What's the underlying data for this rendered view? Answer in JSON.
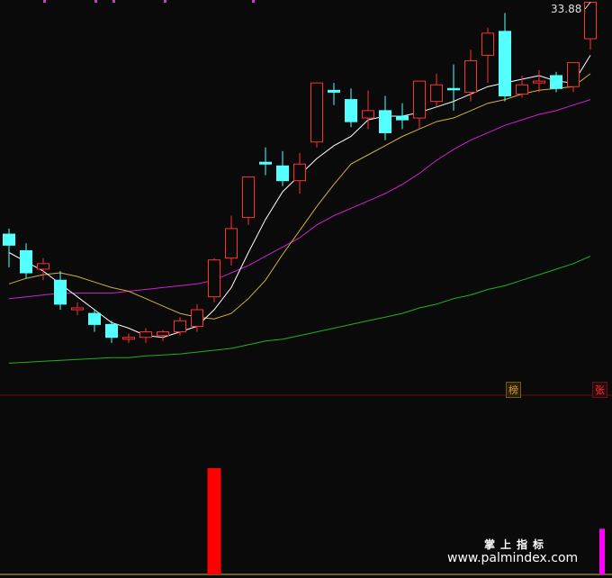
{
  "price_label": "33.88",
  "tags": {
    "bang": "榜",
    "zhang": "张"
  },
  "watermark": {
    "line1": "掌上指标",
    "line2": "www.palmindex.com"
  },
  "colors": {
    "bull": "#ff3030",
    "bear": "#54ffff",
    "ma5": "#ffffff",
    "ma10": "#d4b03a",
    "ma20": "#d020d0",
    "ma60": "#20b020",
    "volume_up": "#ff0000",
    "volume_magenta": "#ff00ff",
    "divider": "#6b1010"
  },
  "chart_data": {
    "type": "candlestick",
    "y_range": [
      13.0,
      34.0
    ],
    "candles": [
      {
        "open": 21.3,
        "close": 20.7,
        "high": 21.6,
        "low": 19.5,
        "up": false
      },
      {
        "open": 20.4,
        "close": 19.2,
        "high": 20.8,
        "low": 18.9,
        "up": false
      },
      {
        "open": 19.4,
        "close": 19.7,
        "high": 20.0,
        "low": 18.8,
        "up": true
      },
      {
        "open": 18.8,
        "close": 17.5,
        "high": 19.3,
        "low": 17.2,
        "up": false
      },
      {
        "open": 17.2,
        "close": 17.3,
        "high": 17.6,
        "low": 16.9,
        "up": true
      },
      {
        "open": 17.0,
        "close": 16.4,
        "high": 17.2,
        "low": 16.0,
        "up": false
      },
      {
        "open": 16.4,
        "close": 15.7,
        "high": 16.6,
        "low": 15.4,
        "up": false
      },
      {
        "open": 15.6,
        "close": 15.7,
        "high": 15.9,
        "low": 15.4,
        "up": true
      },
      {
        "open": 15.7,
        "close": 16.0,
        "high": 16.2,
        "low": 15.4,
        "up": true
      },
      {
        "open": 15.8,
        "close": 16.0,
        "high": 16.1,
        "low": 15.5,
        "up": true
      },
      {
        "open": 16.0,
        "close": 16.6,
        "high": 16.8,
        "low": 15.8,
        "up": true
      },
      {
        "open": 16.3,
        "close": 17.2,
        "high": 17.5,
        "low": 16.0,
        "up": true
      },
      {
        "open": 17.9,
        "close": 19.9,
        "high": 20.0,
        "low": 17.6,
        "up": true
      },
      {
        "open": 20.0,
        "close": 21.6,
        "high": 22.3,
        "low": 19.6,
        "up": true
      },
      {
        "open": 22.2,
        "close": 24.4,
        "high": 24.4,
        "low": 21.8,
        "up": true
      },
      {
        "open": 25.2,
        "close": 25.1,
        "high": 26.0,
        "low": 24.5,
        "up": false
      },
      {
        "open": 25.0,
        "close": 24.2,
        "high": 25.8,
        "low": 23.9,
        "up": false
      },
      {
        "open": 24.2,
        "close": 25.1,
        "high": 25.7,
        "low": 23.5,
        "up": true
      },
      {
        "open": 26.3,
        "close": 29.5,
        "high": 29.5,
        "low": 26.0,
        "up": true
      },
      {
        "open": 29.1,
        "close": 29.0,
        "high": 29.5,
        "low": 28.3,
        "up": false
      },
      {
        "open": 28.6,
        "close": 27.4,
        "high": 29.2,
        "low": 27.1,
        "up": false
      },
      {
        "open": 27.6,
        "close": 28.0,
        "high": 29.1,
        "low": 27.0,
        "up": true
      },
      {
        "open": 28.0,
        "close": 26.8,
        "high": 28.8,
        "low": 26.4,
        "up": false
      },
      {
        "open": 27.7,
        "close": 27.5,
        "high": 28.4,
        "low": 27.0,
        "up": false
      },
      {
        "open": 27.6,
        "close": 29.6,
        "high": 29.6,
        "low": 27.0,
        "up": true
      },
      {
        "open": 28.5,
        "close": 29.4,
        "high": 30.0,
        "low": 28.2,
        "up": true
      },
      {
        "open": 29.2,
        "close": 29.2,
        "high": 30.5,
        "low": 28.0,
        "up": false
      },
      {
        "open": 29.0,
        "close": 30.7,
        "high": 31.3,
        "low": 28.5,
        "up": true
      },
      {
        "open": 31.0,
        "close": 32.2,
        "high": 32.5,
        "low": 29.5,
        "up": true
      },
      {
        "open": 32.3,
        "close": 28.8,
        "high": 33.3,
        "low": 28.5,
        "up": false
      },
      {
        "open": 28.9,
        "close": 29.4,
        "high": 29.9,
        "low": 28.7,
        "up": true
      },
      {
        "open": 29.5,
        "close": 29.6,
        "high": 30.2,
        "low": 29.0,
        "up": true
      },
      {
        "open": 29.9,
        "close": 29.2,
        "high": 30.1,
        "low": 29.0,
        "up": false
      },
      {
        "open": 29.3,
        "close": 30.6,
        "high": 30.6,
        "low": 29.0,
        "up": true
      },
      {
        "open": 31.9,
        "close": 33.88,
        "high": 33.88,
        "low": 31.3,
        "up": true
      }
    ],
    "ma5": [
      20.3,
      19.8,
      19.3,
      18.6,
      17.9,
      17.2,
      16.5,
      16.2,
      15.8,
      15.7,
      16.0,
      16.3,
      17.2,
      18.4,
      20.3,
      22.1,
      23.6,
      24.5,
      25.4,
      26.1,
      26.6,
      27.5,
      27.7,
      27.7,
      27.9,
      28.2,
      28.5,
      28.9,
      29.3,
      29.5,
      29.7,
      29.9,
      29.6,
      29.5,
      31.0
    ],
    "ma10": [
      18.6,
      18.9,
      19.1,
      19.2,
      19.0,
      18.7,
      18.4,
      18.2,
      17.8,
      17.4,
      17.0,
      16.8,
      16.7,
      17.0,
      17.8,
      18.8,
      20.2,
      21.5,
      22.8,
      24.0,
      25.1,
      25.6,
      26.1,
      26.6,
      27.0,
      27.4,
      27.6,
      28.0,
      28.4,
      28.6,
      28.9,
      29.1,
      29.2,
      29.3,
      30.0
    ],
    "ma20": [
      17.8,
      17.9,
      18.0,
      18.1,
      18.1,
      18.1,
      18.1,
      18.2,
      18.3,
      18.4,
      18.5,
      18.6,
      18.8,
      19.2,
      19.6,
      20.1,
      20.6,
      21.1,
      21.8,
      22.3,
      22.7,
      23.1,
      23.5,
      24.0,
      24.6,
      25.3,
      25.9,
      26.4,
      26.8,
      27.2,
      27.5,
      27.8,
      28.0,
      28.3,
      28.6
    ],
    "ma60": [
      14.3,
      14.35,
      14.4,
      14.45,
      14.5,
      14.55,
      14.6,
      14.6,
      14.7,
      14.75,
      14.8,
      14.9,
      15.0,
      15.1,
      15.3,
      15.5,
      15.6,
      15.8,
      16.0,
      16.2,
      16.4,
      16.6,
      16.8,
      17.0,
      17.3,
      17.5,
      17.8,
      18.0,
      18.3,
      18.5,
      18.8,
      19.1,
      19.4,
      19.7,
      20.1
    ],
    "volume_bars": [
      {
        "index": 12,
        "value": 1.0,
        "color": "volume_up"
      },
      {
        "index": 34,
        "value": 0.43,
        "color": "volume_magenta"
      }
    ]
  }
}
